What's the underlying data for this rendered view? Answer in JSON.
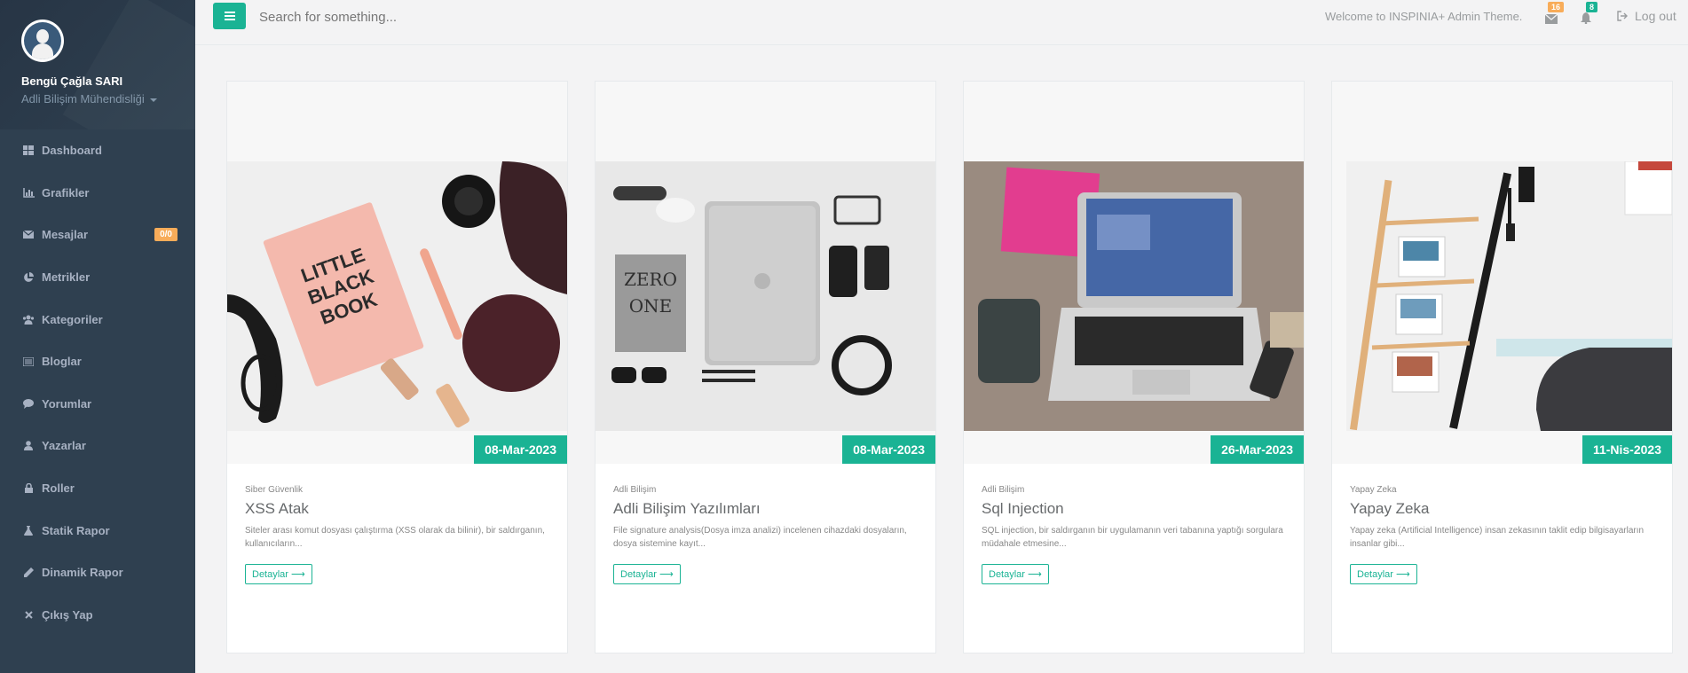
{
  "colors": {
    "accent": "#1ab394",
    "sidebar_bg": "#2f4050",
    "warning": "#f8ac59"
  },
  "profile": {
    "name": "Bengü Çağla SARI",
    "role": "Adli Bilişim Mühendisliği"
  },
  "sidebar": {
    "items": [
      {
        "label": "Dashboard",
        "icon": "dashboard-icon"
      },
      {
        "label": "Grafikler",
        "icon": "chart-icon"
      },
      {
        "label": "Mesajlar",
        "icon": "envelope-icon",
        "badge": "0/0"
      },
      {
        "label": "Metrikler",
        "icon": "pie-chart-icon"
      },
      {
        "label": "Kategoriler",
        "icon": "users-icon"
      },
      {
        "label": "Bloglar",
        "icon": "list-icon"
      },
      {
        "label": "Yorumlar",
        "icon": "comment-icon"
      },
      {
        "label": "Yazarlar",
        "icon": "user-icon"
      },
      {
        "label": "Roller",
        "icon": "lock-icon"
      },
      {
        "label": "Statik Rapor",
        "icon": "flask-icon"
      },
      {
        "label": "Dinamik Rapor",
        "icon": "pencil-icon"
      },
      {
        "label": "Çıkış Yap",
        "icon": "close-icon"
      }
    ]
  },
  "topbar": {
    "search_placeholder": "Search for something...",
    "welcome": "Welcome to INSPINIA+ Admin Theme.",
    "messages_count": "16",
    "alerts_count": "8",
    "logout": "Log out"
  },
  "cards": [
    {
      "date": "08-Mar-2023",
      "category": "Siber Güvenlik",
      "title": "XSS Atak",
      "text": "Siteler arası komut dosyası çalıştırma (XSS olarak da bilinir), bir saldırganın, kullanıcıların...",
      "button": "Detaylar ⟶",
      "image": "little-black-book-flatlay"
    },
    {
      "date": "08-Mar-2023",
      "category": "Adli Bilişim",
      "title": "Adli Bilişim Yazılımları",
      "text": "File signature analysis(Dosya imza analizi) incelenen cihazdaki dosyaların, dosya sistemine kayıt...",
      "button": "Detaylar ⟶",
      "image": "zero-to-one-laptop-flatlay"
    },
    {
      "date": "26-Mar-2023",
      "category": "Adli Bilişim",
      "title": "Sql Injection",
      "text": "SQL injection, bir saldırganın bir uygulamanın veri tabanına yaptığı sorgulara müdahale etmesine...",
      "button": "Detaylar ⟶",
      "image": "laptop-on-wood-desk"
    },
    {
      "date": "11-Nis-2023",
      "category": "Yapay Zeka",
      "title": "Yapay Zeka",
      "text": "Yapay zeka (Artificial Intelligence) insan zekasının taklit edip bilgisayarların insanlar gibi...",
      "button": "Detaylar ⟶",
      "image": "ladder-shelf-room"
    }
  ]
}
